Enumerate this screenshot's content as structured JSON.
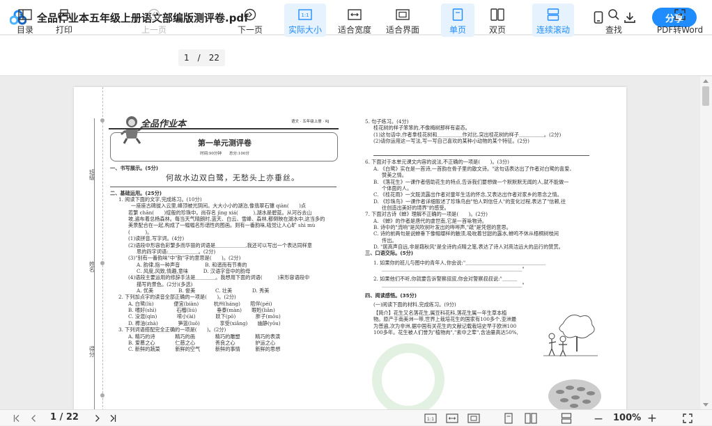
{
  "titlebar": {
    "doc_title": "全品作业本五年级上册语文部编版测评卷.pdf",
    "share_label": "分享",
    "icons": [
      "phone-icon",
      "download-icon"
    ]
  },
  "toolbar": {
    "toc": "目录",
    "print": "打印",
    "prev_page": "上一页",
    "current_page": "1",
    "separator": "/",
    "total_pages": "22",
    "next_page": "下一页",
    "actual_size": "实际大小",
    "fit_width": "适合宽度",
    "fit_page": "适合界面",
    "single_page": "单页",
    "double_page": "双页",
    "continuous": "连续滚动",
    "find": "查找",
    "pdf_to_word": "PDF转Word",
    "actual_size_icon_text": "1:1"
  },
  "document": {
    "brand": "全品作业本",
    "subject": "语文 · 五年级上册 · RJ",
    "exam_title": "第一单元测评卷",
    "exam_meta": "时间:90分钟　　总分:100分",
    "margin_labels": [
      "班级",
      "姓名",
      "得分"
    ],
    "left_column": [
      "一、书写展示。(5分)",
      "何故水边双白鹭，无愁头上亦垂丝。",
      "二、基础运用。(25分)",
      "1. 阅读下面的文字,完成练习。(10分)",
      "一座座古碑拔入云里,峰顶被光阴间。大大小小的湖泊,像翡翠石镶 qiàn(　　)点",
      "若繁 chān(　　)绽般的珍珠中。尚存名 jìng xiá(　　　),湖水是碧蓝。从河谷去山",
      "坡,遍布着总杨森林。每当天气晴朗时,蓝天、白云、雪峰、森林,都倒映在湖水中,这当多的",
      "美景配合在一起,构成了一幅幅名形谐性的图画。则有一番韵味,吸觉让人心旷 shì mù",
      "(　　　)。",
      "(1)读拼音,写字词。(4分)",
      "(2)语段中形容色彩繁多而华丽的词语是＿＿＿＿＿＿,我还可以写出一个表达同样意",
      "思的四字词语:＿＿＿＿＿＿。(2分)",
      "(3)\"别有一番韵味\"中\"韵\"字的意思是(　　)。(2分)",
      "A. 韵律,指一种声音　　　　　B. 和谐而有节奏的",
      "C. 风度,风致,情趣,意味　　　D. 汉语字音中的韵母",
      "(4)语段主要运用的修辞手法是＿＿＿＿。我想用下面的词语(　　　)来形容语段中",
      "描写的景色。(2分)(多选)",
      "A. 优美　　　　　B. 俊美　　　　C. 壮美　　　　D. 秀美",
      "2. 下列加点字的读音全部正确的一项是(　　)。(2分)",
      "A. 白鹭(lù)　　　　便宜(biàn)　　　杭州(háng)　　陪伴(péi)",
      "B. 嗜好(shì)　　　　石榴(liú)　　　　垂泰(màn)　　眼睑(liǎn)",
      "C. 没混(qìn)　　　　嗦小(ài)　　　　跃下(pō)　　　　胖子(mǒu)",
      "D. 榫油(zhà)　　　　笋篮(luǒ)　　　　享受(xiǎng)　　幽静(yōu)",
      "3. 下列词语搭配完全正确的一项是(　　)。(2分)",
      "A. 精巧的诗　　　　精巧的画　　　　精巧的雕塑　　　精巧的表演",
      "B. 爱慕之心　　　　仁慈之心　　　　善良之心　　　　护运之心",
      "C. 新鲜的蔬菜　　　新鲜的空气　　　新鲜的事情　　　新鲜的思想"
    ],
    "right_column": [
      "5. 句子练习。(4分)",
      "桂花树的样子笨笨的,不像梅树那样有姿态。",
      "(1)这句话中,作者拿桂花树和＿＿＿＿＿作对比,突出桂花树的样子＿＿＿＿＿。(2分)",
      "(2)请你运用这一写法,写一写自己喜欢的某种小动物的某个特征。(2分)",
      "6. 下面对于本单元课文内容的说法,不正确的一项是(　　)。(3分)",
      "A. 《白鹭》实在是一首诗,一首韵在骨子里的散文诗。\"这句话表达出了作者对白鹭的喜爱、",
      "赞美之情。",
      "B. 《落花生》一课作者借助花生的特点,告诉我们要想做一个默默默无闻的人,就不能做一",
      "个体面的人。",
      "C. 《桂花雨》一文既流露出作者对童年生活的怀念,又表达出作者对家乡的思念之情。",
      "D. 《珍珠鸟》一课作者详细叙述了珍珠鸟由\"怕人到信任人\"的变化过程,表达了\"信赖,往",
      "往创造出美好的境界\"的感受。",
      "7. 下面对古诗《蝉》理解不正确的一项是(　　)。(2分)",
      "A. 《蝉》的作者是唐代的虞世南,它是一首咏物诗。",
      "B. 诗中的\"流响\"是风吹树叶发出的哗哗声,\"疏\"是凭借的意思。",
      "C. 诗的前两句是说蝉垂下像帽缨样的触须,吸吮着甘甜的露水,蝉鸣不休从梧桐树枝间",
      "传出。",
      "D. \"居高声自远,非是藉秋风\"是全诗的点睛之笔,表达了诗人对高洁远大的品行的赞赏。",
      "三、口语交际。(5分)",
      "1. 如果你的班儿与图中的青年人,你会说:\"＿＿＿＿＿＿＿＿＿＿＿＿＿＿＿＿",
      "＿＿＿＿＿＿＿＿＿＿＿＿＿＿＿＿＿＿＿＿＿＿＿＿＿＿＿＿\"",
      "2. 如果他们不听,你就要告诉警察叔叔,你会对警察叔叔说:\"＿＿＿",
      "＿＿＿＿＿＿＿＿＿＿＿＿＿＿＿＿＿＿＿＿＿＿＿＿＿＿＿＿\"",
      "四、阅读感悟。(35分)",
      "(一)阅读下面的材料,完成练习。(9分)",
      "【简介】花生又名落花生,属豆科花科,落花生属一年生草本植",
      "物。原产于南美洲一带,世界上栽培花生的国家有100多个,亚洲最",
      "为普遍,次为非洲,据中国有关花生的文献记载栽培史早于欧洲100",
      "100多年。花生被人们誉为\"植物肉\",\"素中之荤\",含油量高达50%,"
    ]
  },
  "bottombar": {
    "current_page": "1",
    "separator": "/",
    "total_pages": "22",
    "zoom": "100%",
    "zoom_out": "—",
    "zoom_in": "+",
    "actual_size_icon_text": "1:1"
  }
}
